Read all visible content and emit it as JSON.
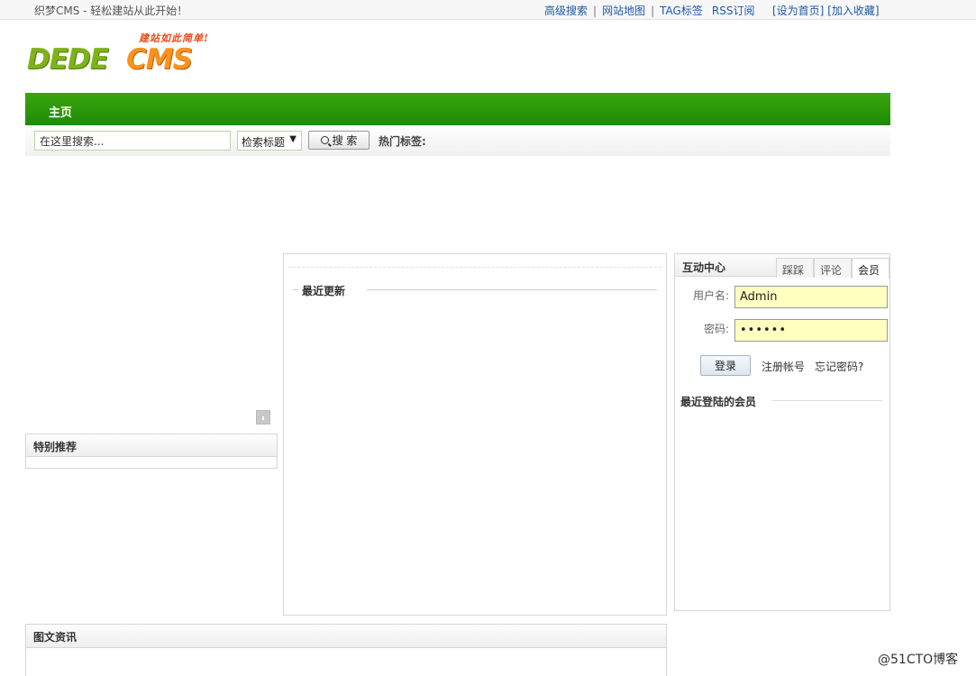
{
  "topbar": {
    "welcome": "织梦CMS - 轻松建站从此开始！",
    "links": [
      "高级搜索",
      "网站地图",
      "TAG标签",
      "RSS订阅"
    ],
    "set_home": "[设为首页]",
    "add_fav": "[加入收藏]"
  },
  "logo": {
    "slogan": "建站如此简单!",
    "brand_left": "DEDE",
    "brand_right": "CMS"
  },
  "nav": {
    "home": "主页"
  },
  "search": {
    "placeholder": "在这里搜索...",
    "type_selected": "检索标题",
    "button_label": "搜 索",
    "hot_tags_label": "热门标签:"
  },
  "left": {
    "recommend_title": "特别推荐"
  },
  "middle": {
    "recent_title": "最近更新"
  },
  "member": {
    "title": "互动中心",
    "tabs": [
      "踩踩",
      "评论",
      "会员"
    ],
    "username_label": "用户名:",
    "username_value": "Admin",
    "password_label": "密码:",
    "password_value": "••••••",
    "login_button": "登录",
    "register_link": "注册帐号",
    "forgot_link": "忘记密码?",
    "recent_members_title": "最近登陆的会员"
  },
  "bottom": {
    "pic_title": "图文资讯"
  },
  "watermark": "@51CTO博客"
}
